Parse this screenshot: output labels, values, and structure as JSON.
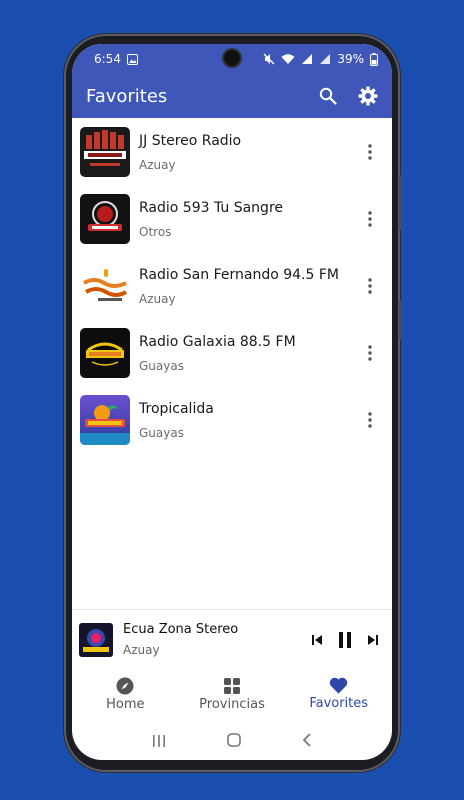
{
  "status": {
    "time": "6:54",
    "battery": "39%"
  },
  "appbar": {
    "title": "Favorites"
  },
  "stations": [
    {
      "name": "JJ Stereo Radio",
      "region": "Azuay"
    },
    {
      "name": "Radio 593 Tu Sangre",
      "region": "Otros"
    },
    {
      "name": "Radio San Fernando 94.5 FM",
      "region": "Azuay"
    },
    {
      "name": "Radio Galaxia 88.5 FM",
      "region": "Guayas"
    },
    {
      "name": "Tropicalida",
      "region": "Guayas"
    }
  ],
  "player": {
    "title": "Ecua Zona Stereo",
    "region": "Azuay"
  },
  "nav": {
    "home": "Home",
    "provincias": "Provincias",
    "favorites": "Favorites"
  },
  "colors": {
    "primary": "#3e57b9",
    "background": "#1a4fb0",
    "active": "#2f47a8"
  }
}
